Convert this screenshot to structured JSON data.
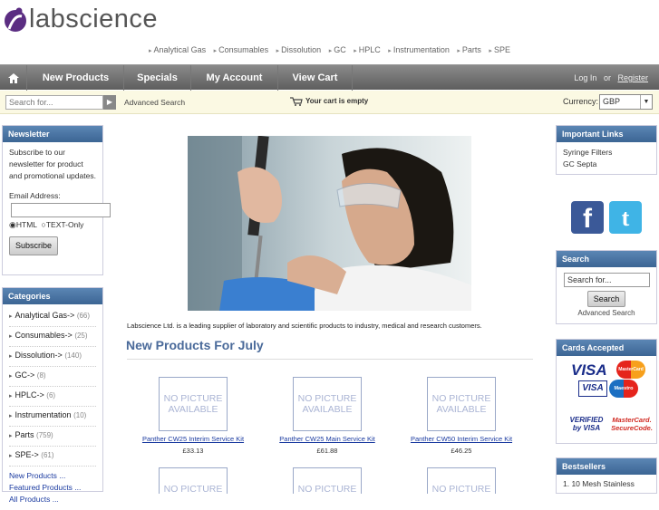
{
  "brand": {
    "name": "labscience"
  },
  "top_links": [
    "Analytical Gas",
    "Consumables",
    "Dissolution",
    "GC",
    "HPLC",
    "Instrumentation",
    "Parts",
    "SPE"
  ],
  "nav": {
    "tabs": [
      "New Products",
      "Specials",
      "My Account",
      "View Cart"
    ],
    "login": "Log In",
    "or": "or",
    "register": "Register"
  },
  "searchbar": {
    "placeholder": "Search for...",
    "go": "▶",
    "advanced": "Advanced Search",
    "cart": "Your cart is empty",
    "currency_label": "Currency:",
    "currency_value": "GBP"
  },
  "newsletter": {
    "title": "Newsletter",
    "text": "Subscribe to our newsletter for product and promotional updates.",
    "email_label": "Email Address:",
    "opt_html": "HTML",
    "opt_text": "TEXT-Only",
    "button": "Subscribe"
  },
  "categories": {
    "title": "Categories",
    "items": [
      {
        "label": "Analytical Gas->",
        "count": "(66)"
      },
      {
        "label": "Consumables->",
        "count": "(25)"
      },
      {
        "label": "Dissolution->",
        "count": "(140)"
      },
      {
        "label": "GC->",
        "count": "(8)"
      },
      {
        "label": "HPLC->",
        "count": "(6)"
      },
      {
        "label": "Instrumentation",
        "count": "(10)"
      },
      {
        "label": "Parts",
        "count": "(759)"
      },
      {
        "label": "SPE->",
        "count": "(61)"
      }
    ],
    "links": [
      "New Products ...",
      "Featured Products ...",
      "All Products ..."
    ]
  },
  "main": {
    "intro": "Labscience Ltd. is a leading supplier of laboratory and scientific products to industry, medical and research customers.",
    "heading": "New Products For July",
    "nopic": "NO PICTURE AVAILABLE",
    "products": [
      {
        "name": "Panther CW25 Interim Service Kit",
        "price": "£33.13"
      },
      {
        "name": "Panther CW25 Main Service Kit",
        "price": "£61.88"
      },
      {
        "name": "Panther CW50 Interim Service Kit",
        "price": "£46.25"
      }
    ]
  },
  "important_links": {
    "title": "Important Links",
    "items": [
      "Syringe Filters",
      "GC Septa"
    ]
  },
  "right_search": {
    "title": "Search",
    "placeholder": "Search for...",
    "button": "Search",
    "advanced": "Advanced Search"
  },
  "cards": {
    "title": "Cards Accepted",
    "visa": "VISA",
    "mastercard": "MasterCard",
    "maestro": "Maestro",
    "verified": "VERIFIED by VISA",
    "securecode": "MasterCard. SecureCode."
  },
  "bestsellers": {
    "title": "Bestsellers",
    "items": [
      "1.  10 Mesh Stainless"
    ]
  },
  "colors": {
    "nav": "#6e6e6e",
    "box_header": "#4a74a2",
    "accent": "#5b2d82"
  }
}
